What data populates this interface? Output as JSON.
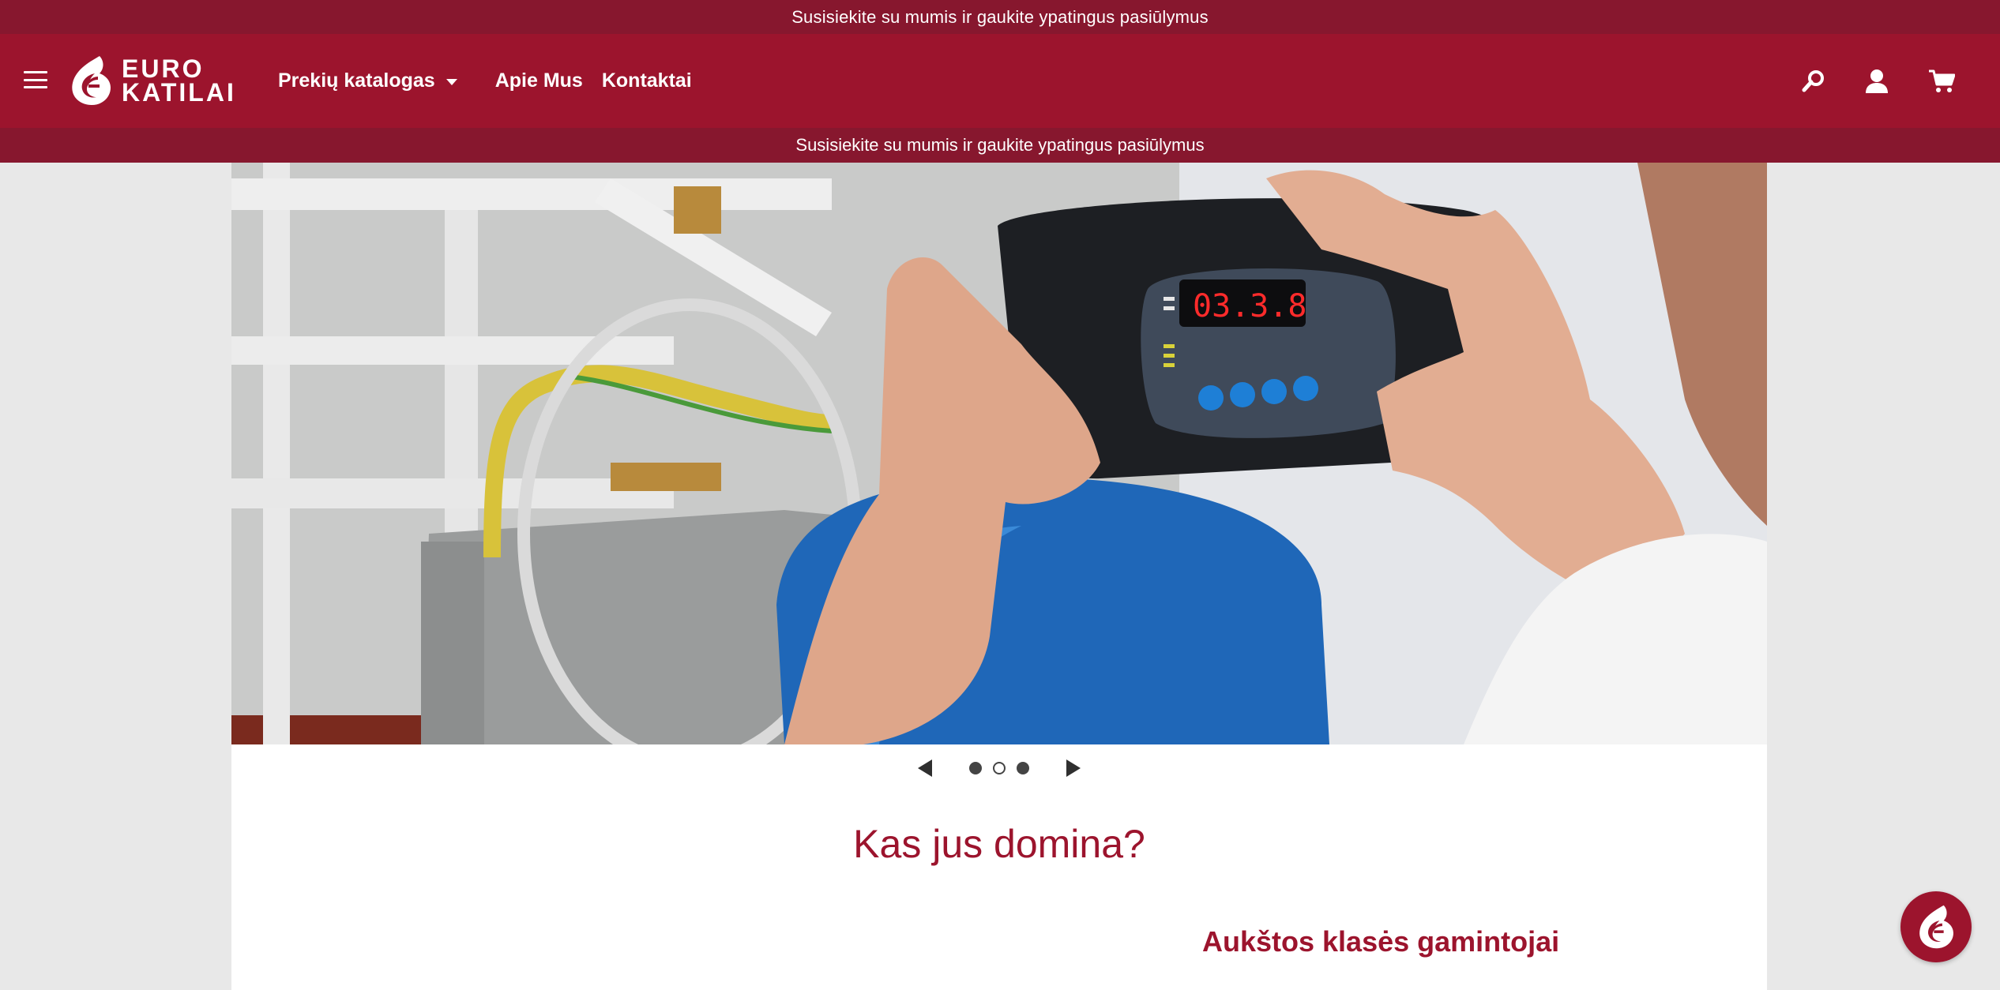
{
  "promo": {
    "top_text": "Susisiekite su mumis ir gaukite ypatingus pasiūlymus",
    "sub_text": "Susisiekite su mumis ir gaukite ypatingus pasiūlymus"
  },
  "header": {
    "logo_line1": "EURO",
    "logo_line2": "KATILAI",
    "nav": {
      "catalog": "Prekių katalogas",
      "about": "Apie Mus",
      "contacts": "Kontaktai"
    },
    "icons": [
      "menu-icon",
      "search-icon",
      "user-icon",
      "cart-icon"
    ]
  },
  "hero": {
    "display_digits": "03.3.8",
    "slides_total": 3,
    "active_slide": 2
  },
  "main": {
    "section_heading": "Kas jus domina?",
    "sub_heading": "Aukštos klasės gamintojai"
  },
  "colors": {
    "brand": "#9c142d",
    "brand_dark": "#87172e",
    "page_bg": "#e8e8e8"
  }
}
